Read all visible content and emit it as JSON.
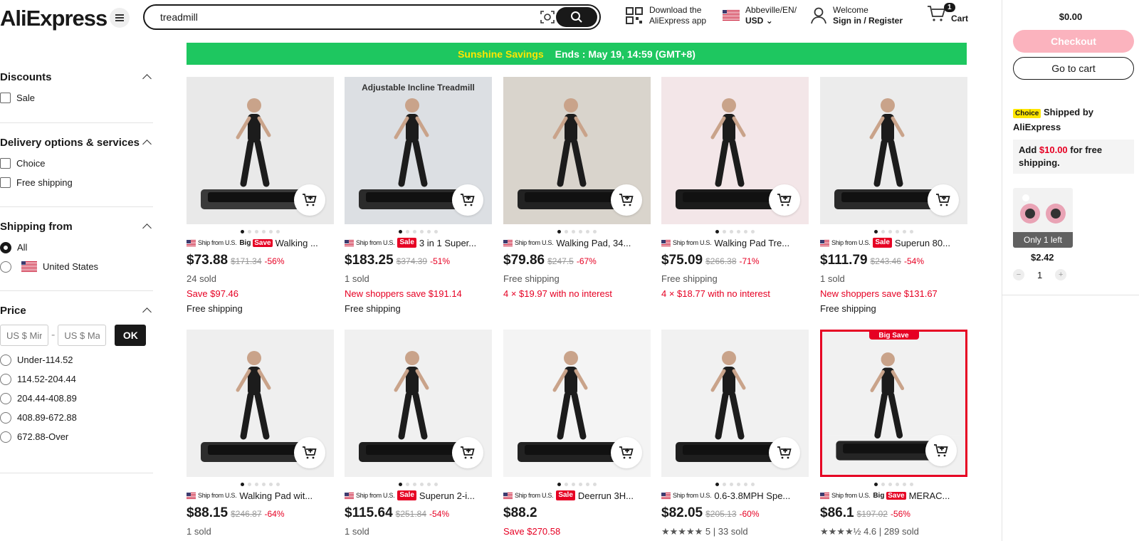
{
  "header": {
    "logo": "AliExpress",
    "search_value": "treadmill",
    "download_line1": "Download the",
    "download_line2": "AliExpress app",
    "location_line1": "Abbeville/EN/",
    "location_line2": "USD",
    "welcome": "Welcome",
    "signin": "Sign in / Register",
    "cart_label": "Cart",
    "cart_count": "1"
  },
  "filters": {
    "discounts": {
      "title": "Discounts",
      "items": [
        "Sale"
      ]
    },
    "delivery": {
      "title": "Delivery options & services",
      "items": [
        "Choice",
        "Free shipping"
      ]
    },
    "shipping_from": {
      "title": "Shipping from",
      "items": [
        "All",
        "United States"
      ],
      "selected": "All"
    },
    "price": {
      "title": "Price",
      "min_placeholder": "US $ Min",
      "max_placeholder": "US $ Max",
      "dash": "-",
      "ok_label": "OK",
      "ranges": [
        "Under-114.52",
        "114.52-204.44",
        "204.44-408.89",
        "408.89-672.88",
        "672.88-Over"
      ]
    }
  },
  "banner": {
    "promo": "Sunshine Savings",
    "ends": "Ends : May 19, 14:59 (GMT+8)"
  },
  "ship_label": "Ship from U.S.",
  "products": [
    {
      "tag": "big",
      "tag_text": "Save",
      "tag_prefix": "Big",
      "name": "Walking ...",
      "price": "$73.88",
      "old": "$171.34",
      "disc": "-56%",
      "l1": "24 sold",
      "l1_red": false,
      "l2": "Save $97.46",
      "l2_red": true,
      "l3": "Free shipping",
      "img_label": ""
    },
    {
      "tag": "sale",
      "tag_text": "Sale",
      "name": "3 in 1 Super...",
      "price": "$183.25",
      "old": "$374.39",
      "disc": "-51%",
      "l1": "1 sold",
      "l1_red": false,
      "l2": "New shoppers save $191.14",
      "l2_red": true,
      "l3": "Free shipping",
      "img_label": "Adjustable Incline Treadmill"
    },
    {
      "tag": "",
      "name": "Walking Pad, 34...",
      "price": "$79.86",
      "old": "$247.5",
      "disc": "-67%",
      "l1": "Free shipping",
      "l1_red": false,
      "l2": "4 × $19.97 with no interest",
      "l2_red": true,
      "l3": "",
      "img_label": ""
    },
    {
      "tag": "",
      "name": "Walking Pad Tre...",
      "price": "$75.09",
      "old": "$266.38",
      "disc": "-71%",
      "l1": "Free shipping",
      "l1_red": false,
      "l2": "4 × $18.77 with no interest",
      "l2_red": true,
      "l3": "",
      "img_label": ""
    },
    {
      "tag": "sale",
      "tag_text": "Sale",
      "name": "Superun 80...",
      "price": "$111.79",
      "old": "$243.46",
      "disc": "-54%",
      "l1": "1 sold",
      "l1_red": false,
      "l2": "New shoppers save $131.67",
      "l2_red": true,
      "l3": "Free shipping",
      "img_label": ""
    },
    {
      "tag": "",
      "name": "Walking Pad wit...",
      "price": "$88.15",
      "old": "$246.87",
      "disc": "-64%",
      "l1": "1 sold",
      "l1_red": false,
      "l2": "",
      "l2_red": false,
      "l3": "",
      "img_label": ""
    },
    {
      "tag": "sale",
      "tag_text": "Sale",
      "name": "Superun 2-i...",
      "price": "$115.64",
      "old": "$251.84",
      "disc": "-54%",
      "l1": "1 sold",
      "l1_red": false,
      "l2": "",
      "l2_red": false,
      "l3": "",
      "img_label": ""
    },
    {
      "tag": "sale",
      "tag_text": "Sale",
      "name": "Deerrun 3H...",
      "price": "$88.2",
      "old": "",
      "disc": "",
      "l1": "Save $270.58",
      "l1_red": true,
      "l2": "",
      "l2_red": false,
      "l3": "",
      "img_label": ""
    },
    {
      "tag": "",
      "name": "0.6-3.8MPH Spe...",
      "price": "$82.05",
      "old": "$205.13",
      "disc": "-60%",
      "l1": "★★★★★ 5 | 33 sold",
      "l1_red": false,
      "l2": "",
      "l2_red": false,
      "l3": "",
      "img_label": ""
    },
    {
      "tag": "big",
      "tag_text": "Save",
      "tag_prefix": "Big",
      "name": "MERAC...",
      "price": "$86.1",
      "old": "$197.02",
      "disc": "-56%",
      "l1": "★★★★½ 4.6 | 289 sold",
      "l1_red": false,
      "l2": "",
      "l2_red": false,
      "l3": "",
      "img_label": "Big Save"
    }
  ],
  "side_cart": {
    "total": "$0.00",
    "checkout": "Checkout",
    "go_to_cart": "Go to cart",
    "choice_tag": "Choice",
    "shipped_by": "Shipped by AliExpress",
    "add_prefix": "Add ",
    "add_amount": "$10.00",
    "add_suffix": " for free shipping.",
    "item_badge": "Only 1 left",
    "item_price": "$2.42",
    "qty": "1",
    "minus": "−",
    "plus": "+"
  },
  "colors": {
    "accent_red": "#e60023",
    "banner_green": "#1ec760",
    "choice_yellow": "#ffe600",
    "checkout_pink": "#fbb3be"
  }
}
